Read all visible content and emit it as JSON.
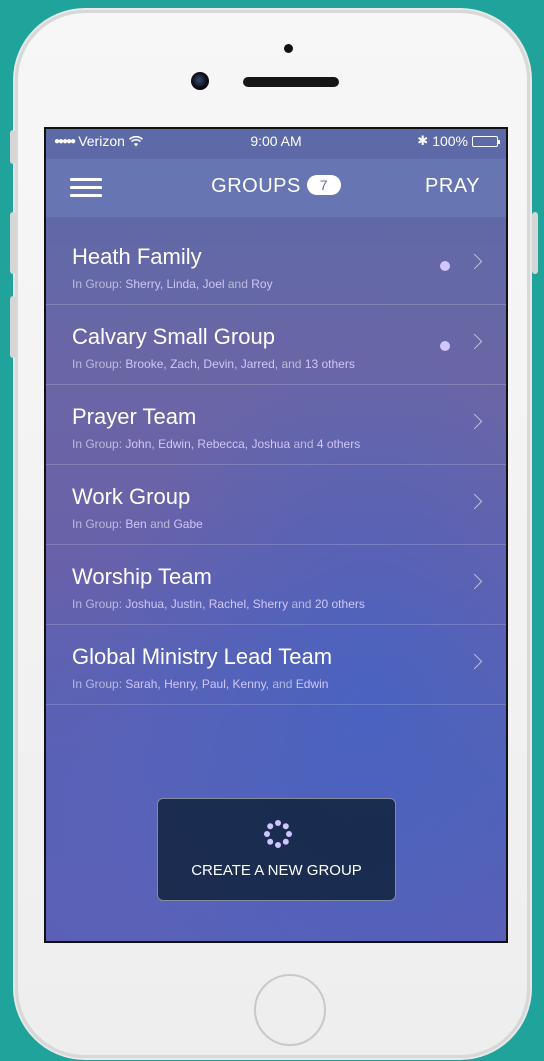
{
  "status_bar": {
    "carrier": "Verizon",
    "time": "9:00 AM",
    "battery": "100%"
  },
  "header": {
    "title": "GROUPS",
    "count": "7",
    "action_label": "PRAY"
  },
  "groups": [
    {
      "name": "Heath Family",
      "prefix": "In Group: ",
      "members": "Sherry, Linda, Joel",
      "conj": " and ",
      "tail": "Roy",
      "unread": true
    },
    {
      "name": "Calvary Small Group",
      "prefix": "In Group: ",
      "members": "Brooke, Zach, Devin, Jarred,",
      "conj": " and ",
      "tail": "13 others",
      "unread": true
    },
    {
      "name": "Prayer Team",
      "prefix": "In Group: ",
      "members": "John, Edwin, Rebecca, Joshua",
      "conj": " and ",
      "tail": "4 others",
      "unread": false
    },
    {
      "name": "Work Group",
      "prefix": "In Group: ",
      "members": "Ben",
      "conj": " and ",
      "tail": "Gabe",
      "unread": false
    },
    {
      "name": "Worship Team",
      "prefix": "In Group: ",
      "members": "Joshua, Justin, Rachel, Sherry",
      "conj": " and ",
      "tail": "20 others",
      "unread": false
    },
    {
      "name": "Global Ministry Lead Team",
      "prefix": "In Group: ",
      "members": "Sarah, Henry, Paul, Kenny,",
      "conj": " and ",
      "tail": "Edwin",
      "unread": false
    }
  ],
  "create_button": {
    "label": "CREATE A NEW GROUP",
    "icon": "spinner-dots-icon"
  },
  "colors": {
    "background": "#1fa39a",
    "unread_dot": "#d2c6ff"
  }
}
